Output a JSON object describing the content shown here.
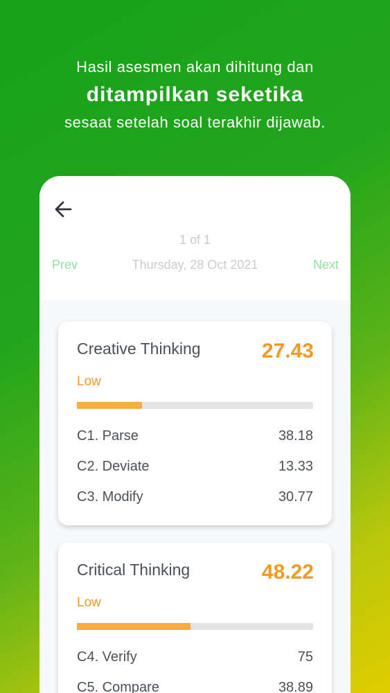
{
  "headline": {
    "line1": "Hasil asesmen akan dihitung dan",
    "line2": "ditampilkan seketika",
    "line3": "sesaat setelah soal terakhir dijawab."
  },
  "header": {
    "back_icon": "arrow-left-icon",
    "pager": "1 of 1",
    "prev_label": "Prev",
    "next_label": "Next",
    "date": "Thursday, 28 Oct 2021"
  },
  "colors": {
    "accent_green": "#8fe39f",
    "score_orange": "#f09a26",
    "bar_orange": "#f6ad48",
    "bar_track": "#e4e4e4"
  },
  "cards": [
    {
      "title": "Creative Thinking",
      "score": "27.43",
      "level": "Low",
      "progress": 0.2743,
      "items": [
        {
          "label": "C1. Parse",
          "value": "38.18"
        },
        {
          "label": "C2. Deviate",
          "value": "13.33"
        },
        {
          "label": "C3. Modify",
          "value": "30.77"
        }
      ]
    },
    {
      "title": "Critical Thinking",
      "score": "48.22",
      "level": "Low",
      "progress": 0.4822,
      "items": [
        {
          "label": "C4. Verify",
          "value": "75"
        },
        {
          "label": "C5. Compare",
          "value": "38.89"
        }
      ]
    }
  ]
}
